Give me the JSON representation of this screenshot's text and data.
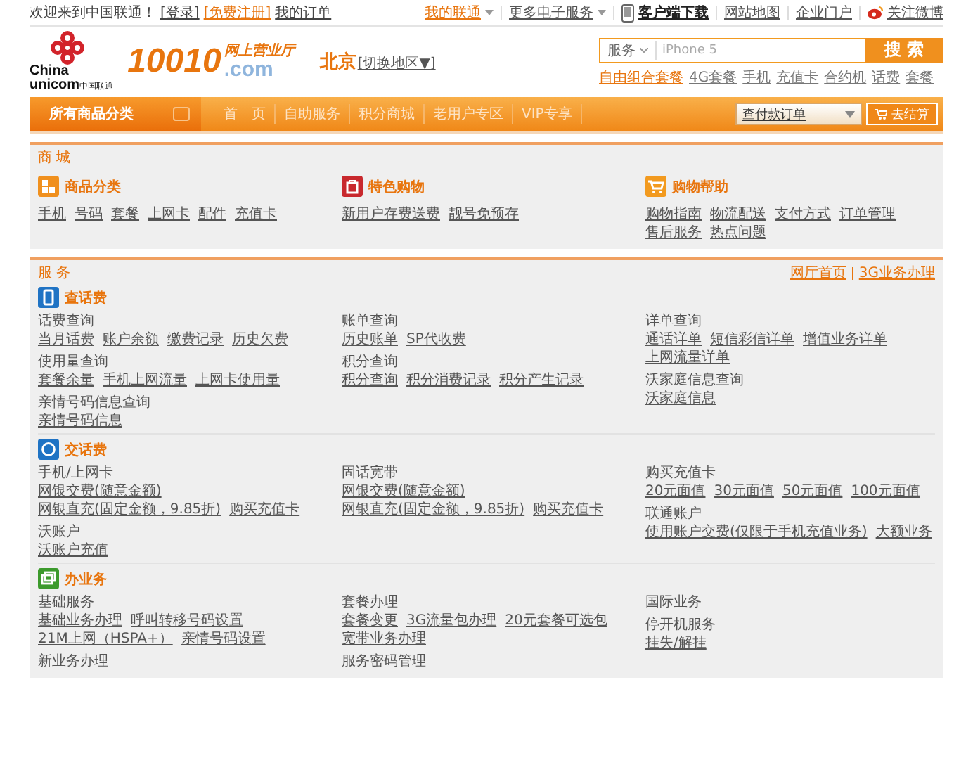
{
  "top_bar": {
    "welcome": "欢迎来到中国联通！",
    "links": [
      "[登录]",
      "[免费注册]",
      "我的订单"
    ],
    "right": [
      {
        "label": "我的联通",
        "kind": "menu",
        "highlight": true
      },
      {
        "label": "更多电子服务",
        "kind": "menu",
        "highlight": false
      },
      {
        "label": "客户端下载",
        "kind": "phone",
        "highlight": false
      },
      {
        "label": "网站地图",
        "kind": "plain",
        "highlight": false
      },
      {
        "label": "企业门户",
        "kind": "plain",
        "highlight": false
      },
      {
        "label": "关注微博",
        "kind": "weibo",
        "highlight": false
      }
    ]
  },
  "header": {
    "logo_en_1": "China",
    "logo_en_2": "unicom",
    "logo_cn": "中国联通",
    "brand": "10010",
    "brand_sub": "网上营业厅",
    "brand_domain": ".com",
    "city": "北京",
    "city_switch": "[切换地区▼]",
    "search": {
      "category": "服务",
      "placeholder": "iPhone 5",
      "button": "搜 索"
    },
    "hot_links": [
      "自由组合套餐",
      "4G套餐",
      "手机",
      "充值卡",
      "合约机",
      "话费",
      "套餐"
    ]
  },
  "nav": {
    "all_categories": "所有商品分类",
    "items": [
      "首　页",
      "自助服务",
      "积分商城",
      "老用户专区",
      "VIP专享"
    ],
    "order_select": "查付款订单",
    "cart": "去结算"
  },
  "mall": {
    "label": "商 城",
    "groups": [
      {
        "title": "商品分类",
        "links": [
          "手机",
          "号码",
          "套餐",
          "上网卡",
          "配件",
          "充值卡"
        ]
      },
      {
        "title": "特色购物",
        "links": [
          "新用户存费送费",
          "靓号免预存"
        ]
      },
      {
        "title": "购物帮助",
        "links": [
          "购物指南",
          "物流配送",
          "支付方式",
          "订单管理",
          "售后服务",
          "热点问题"
        ]
      }
    ]
  },
  "service": {
    "label": "服 务",
    "links": [
      "网厅首页",
      "3G业务办理"
    ],
    "sections": [
      {
        "title": "查话费",
        "columns": [
          [
            {
              "title": "话费查询",
              "links": [
                "当月话费",
                "账户余额",
                "缴费记录",
                "历史欠费"
              ]
            },
            {
              "title": "使用量查询",
              "links": [
                "套餐余量",
                "手机上网流量",
                "上网卡使用量"
              ]
            },
            {
              "title": "亲情号码信息查询",
              "links": [
                "亲情号码信息"
              ]
            }
          ],
          [
            {
              "title": "账单查询",
              "links": [
                "历史账单",
                "SP代收费"
              ]
            },
            {
              "title": "积分查询",
              "links": [
                "积分查询",
                "积分消费记录",
                "积分产生记录"
              ]
            }
          ],
          [
            {
              "title": "详单查询",
              "links": [
                "通话详单",
                "短信彩信详单",
                "增值业务详单",
                "上网流量详单"
              ]
            },
            {
              "title": "沃家庭信息查询",
              "links": [
                "沃家庭信息"
              ]
            }
          ]
        ]
      },
      {
        "title": "交话费",
        "columns": [
          [
            {
              "title": "手机/上网卡",
              "links": [
                "网银交费(随意金额)",
                "网银直充(固定金额，9.85折)",
                "购买充值卡"
              ]
            },
            {
              "title": "沃账户",
              "links": [
                "沃账户充值"
              ]
            }
          ],
          [
            {
              "title": "固话宽带",
              "links": [
                "网银交费(随意金额)",
                "网银直充(固定金额，9.85折)",
                "购买充值卡"
              ]
            }
          ],
          [
            {
              "title": "购买充值卡",
              "links": [
                "20元面值",
                "30元面值",
                "50元面值",
                "100元面值"
              ]
            },
            {
              "title": "联通账户",
              "links": [
                "使用账户交费(仅限于手机充值业务)",
                "大额业务"
              ]
            }
          ]
        ]
      },
      {
        "title": "办业务",
        "columns": [
          [
            {
              "title": "基础服务",
              "links": [
                "基础业务办理",
                "呼叫转移号码设置",
                "21M上网（HSPA+）",
                "亲情号码设置"
              ]
            },
            {
              "title": "新业务办理"
            }
          ],
          [
            {
              "title": "套餐办理",
              "links": [
                "套餐变更",
                "3G流量包办理",
                "20元套餐可选包",
                "宽带业务办理"
              ]
            },
            {
              "title": "服务密码管理"
            }
          ],
          [
            {
              "title": "国际业务"
            },
            {
              "title": "停开机服务",
              "links": [
                "挂失/解挂"
              ]
            }
          ]
        ]
      }
    ]
  }
}
